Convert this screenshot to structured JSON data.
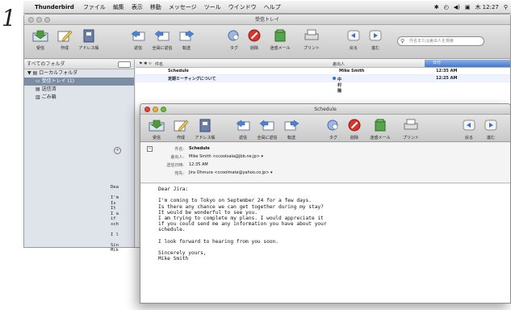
{
  "step_number": "1",
  "menubar": {
    "app": "Thunderbird",
    "items": [
      "ファイル",
      "編集",
      "表示",
      "移動",
      "メッセージ",
      "ツール",
      "ウインドウ",
      "ヘルプ"
    ],
    "clock": "木 12:27"
  },
  "main_window": {
    "title": "受信トレイ",
    "toolbar": [
      {
        "label": "受信",
        "icon": "inbox-download-icon"
      },
      {
        "label": "作成",
        "icon": "compose-pencil-icon"
      },
      {
        "label": "アドレス帳",
        "icon": "address-book-icon"
      },
      {
        "label": "返信",
        "icon": "reply-icon"
      },
      {
        "label": "全員に返信",
        "icon": "reply-all-icon"
      },
      {
        "label": "転送",
        "icon": "forward-icon"
      },
      {
        "label": "タグ",
        "icon": "tag-icon"
      },
      {
        "label": "削除",
        "icon": "delete-icon"
      },
      {
        "label": "迷惑メール",
        "icon": "junk-icon"
      },
      {
        "label": "プリント",
        "icon": "print-icon"
      },
      {
        "label": "戻る",
        "icon": "back-arrow-icon"
      },
      {
        "label": "進む",
        "icon": "forward-arrow-icon"
      }
    ],
    "search_placeholder": "件名または差出人を検索",
    "folder_header": "すべてのフォルダ",
    "folders": [
      {
        "label": "ローカルフォルダ",
        "selected": false
      },
      {
        "label": "受信トレイ (1)",
        "selected": true
      },
      {
        "label": "送信済",
        "selected": false
      },
      {
        "label": "ごみ箱",
        "selected": false
      }
    ],
    "columns": {
      "subject": "件名",
      "sender": "差出人",
      "date": "日付"
    },
    "messages": [
      {
        "subject": "Schedule",
        "sender": "Mike Smith",
        "date": "12:35 AM"
      },
      {
        "subject": "定期ミーティングについて",
        "sender": "中村陽",
        "date": "12:25 AM"
      }
    ]
  },
  "message_window": {
    "title": "Schedule",
    "headers": [
      {
        "key": "件名:",
        "value": "Schedule"
      },
      {
        "key": "差出人:",
        "value": "Mike Smith <ccooloala@jbb.ne.jp> ▾"
      },
      {
        "key": "送信日時:",
        "value": "12:35 AM"
      },
      {
        "key": "宛先:",
        "value": "Jira Ohmura <ccoolmate@yahoo.co.jp> ▾"
      }
    ],
    "body_lines": [
      "Dear Jira:",
      "",
      "I'm coming to Tokyo on September 24 for a few days.",
      "Is there any chance we can get together during my stay?",
      "It would be wonderful to see you.",
      "I am trying to complete my plans. I would appreciate it",
      "if you could send me any information you have about your",
      "schedule.",
      "",
      "I look forward to hearing from you soon.",
      "",
      "Sincerely yours,",
      "Mike Smith"
    ]
  },
  "background_fragment_lines": [
    "Dea",
    "",
    "I'm",
    "Is",
    "It",
    "I a",
    "if",
    "sch",
    "",
    "I l",
    "",
    "Sin",
    "Mik"
  ]
}
